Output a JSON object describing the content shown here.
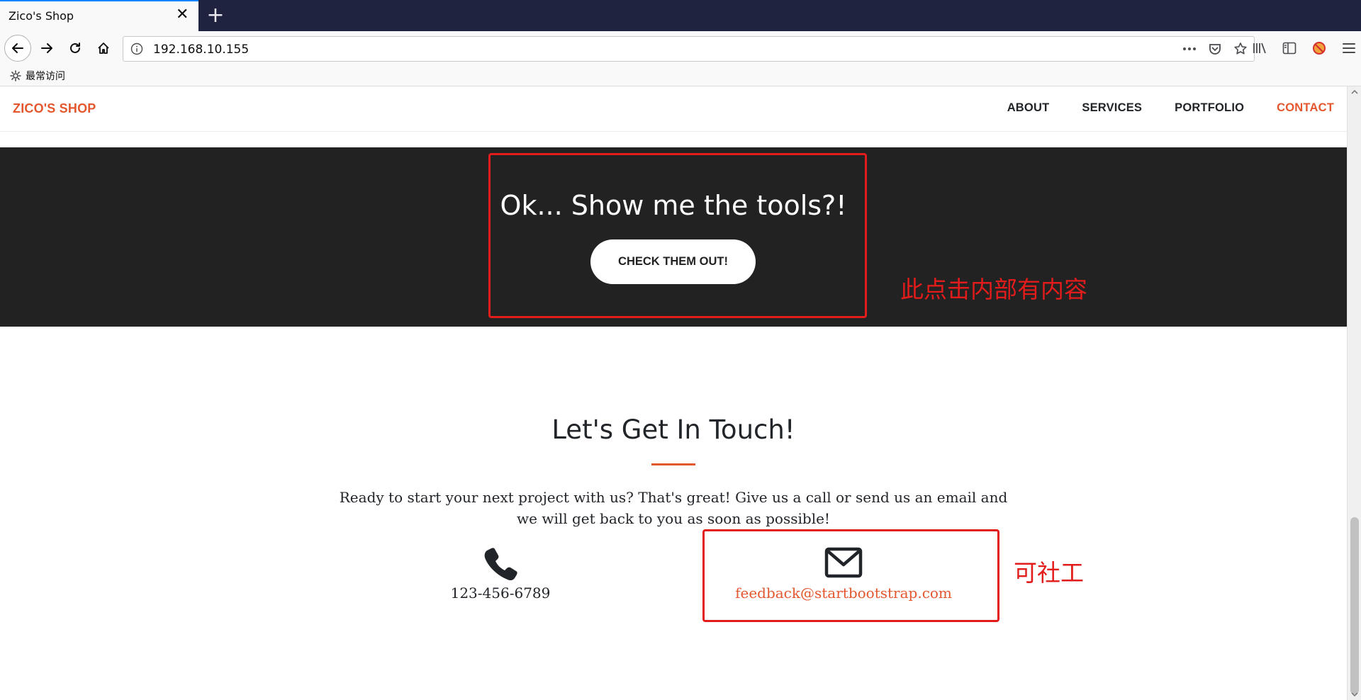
{
  "browser": {
    "tab_title": "Zico's Shop",
    "tab_close": "✕",
    "new_tab": "+",
    "url": "192.168.10.155",
    "bookmark_label": "最常访问"
  },
  "site": {
    "brand": "ZICO'S SHOP",
    "nav": [
      {
        "label": "ABOUT",
        "active": false
      },
      {
        "label": "SERVICES",
        "active": false
      },
      {
        "label": "PORTFOLIO",
        "active": false
      },
      {
        "label": "CONTACT",
        "active": true
      }
    ]
  },
  "tools_section": {
    "title": "Ok... Show me the tools?!",
    "button": "CHECK THEM OUT!"
  },
  "contact_section": {
    "title": "Let's Get In Touch!",
    "text": "Ready to start your next project with us? That's great! Give us a call or send us an email and we will get back to you as soon as possible!",
    "phone": "123-456-6789",
    "email": "feedback@startbootstrap.com"
  },
  "annotations": {
    "note_1": "此点击内部有内容",
    "note_2": "可社工"
  },
  "colors": {
    "accent": "#e4572e",
    "dark_band": "#222222",
    "annotation": "#e21b1b",
    "tabbar": "#202340"
  }
}
